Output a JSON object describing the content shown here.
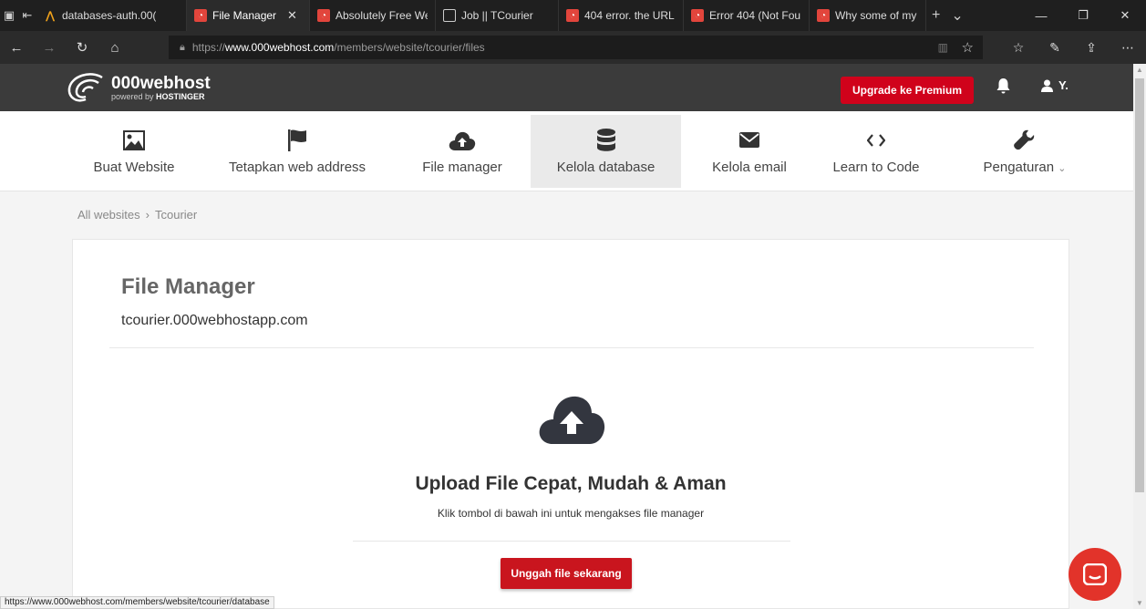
{
  "browser": {
    "tabs": [
      {
        "label": "databases-auth.00(",
        "icon": "000webhost-logo-icon"
      },
      {
        "label": "File Manager",
        "icon": "000webhost-favicon",
        "active": true
      },
      {
        "label": "Absolutely Free We",
        "icon": "000webhost-favicon"
      },
      {
        "label": "Job || TCourier",
        "icon": "page-icon"
      },
      {
        "label": "404 error. the URL",
        "icon": "000webhost-favicon"
      },
      {
        "label": "Error 404 (Not Fou",
        "icon": "000webhost-favicon"
      },
      {
        "label": "Why some of my w",
        "icon": "000webhost-favicon"
      }
    ],
    "url_prefix": "https://",
    "url_host": "www.000webhost.com",
    "url_path": "/members/website/tcourier/files",
    "status_url": "https://www.000webhost.com/members/website/tcourier/database"
  },
  "header": {
    "brand": "000webhost",
    "powered_by": "powered by",
    "powered_by_brand": "HOSTINGER",
    "upgrade_label": "Upgrade ke Premium",
    "user_label": "Y."
  },
  "nav": {
    "items": [
      {
        "label": "Buat Website",
        "icon": "image-icon"
      },
      {
        "label": "Tetapkan web address",
        "icon": "flag-icon"
      },
      {
        "label": "File manager",
        "icon": "cloud-upload-icon"
      },
      {
        "label": "Kelola database",
        "icon": "database-icon",
        "active": true
      },
      {
        "label": "Kelola email",
        "icon": "envelope-icon"
      },
      {
        "label": "Learn to Code",
        "icon": "code-icon"
      },
      {
        "label": "Pengaturan",
        "icon": "wrench-icon"
      }
    ]
  },
  "breadcrumb": {
    "root": "All websites",
    "separator": "›",
    "current": "Tcourier"
  },
  "card": {
    "title": "File Manager",
    "domain": "tcourier.000webhostapp.com",
    "heading": "Upload File Cepat, Mudah & Aman",
    "hint": "Klik tombol di bawah ini untuk mengakses file manager",
    "upload_label": "Unggah file sekarang"
  },
  "colors": {
    "accent": "#d0021b",
    "header_bg": "#3b3b3b",
    "chat": "#e2332a"
  }
}
